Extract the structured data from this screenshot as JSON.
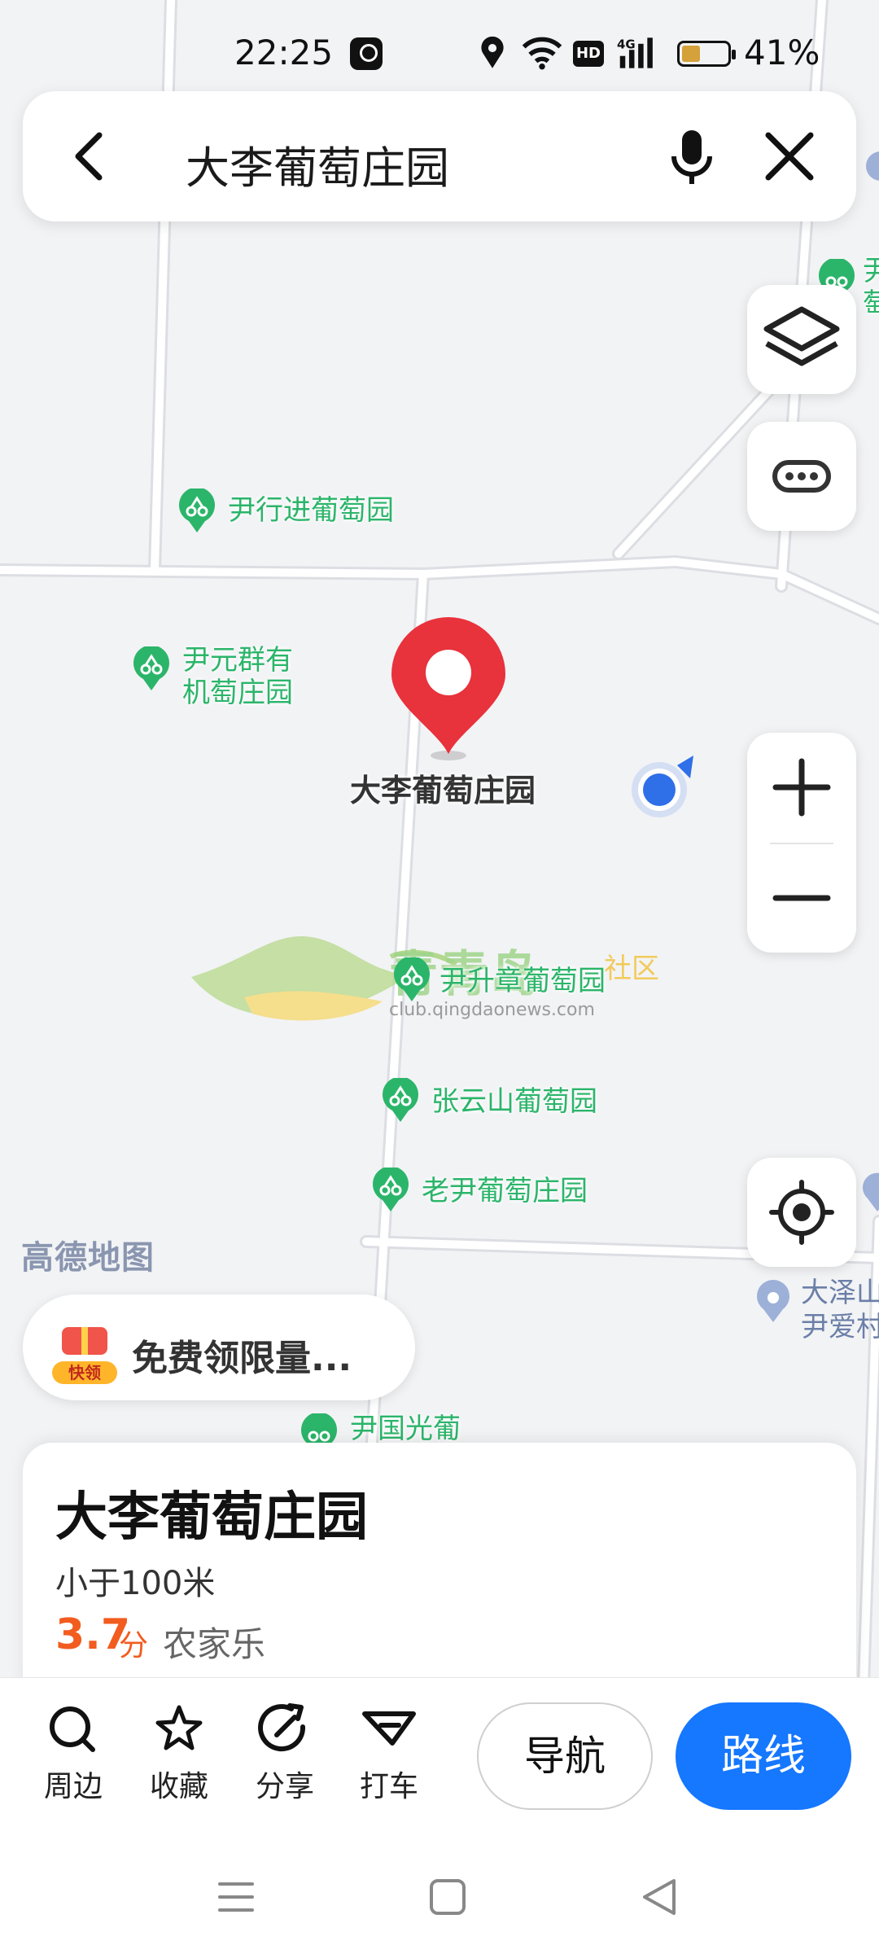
{
  "status_bar": {
    "time": "22:25",
    "battery_percent": "41%",
    "battery_level": 0.41,
    "icons": [
      "app-badge-icon",
      "location-icon",
      "wifi-icon",
      "hd-icon",
      "4g-signal-icon",
      "battery-icon"
    ]
  },
  "search": {
    "query": "大李葡萄庄园",
    "icons": [
      "back-arrow-icon",
      "microphone-icon",
      "close-icon"
    ]
  },
  "map": {
    "brand_watermark": "高德地图",
    "selected_marker_label": "大李葡萄庄园",
    "pois": [
      {
        "label_line1": "尹行进葡萄园",
        "label_line2": ""
      },
      {
        "label_line1": "尹元群有",
        "label_line2": "机萄庄园"
      },
      {
        "label_line1": "尹升章葡萄园",
        "label_line2": ""
      },
      {
        "label_line1": "张云山葡萄园",
        "label_line2": ""
      },
      {
        "label_line1": "老尹葡萄庄园",
        "label_line2": ""
      },
      {
        "label_line1": "尹国光葡",
        "label_line2": ""
      }
    ],
    "edge_labels": {
      "top_right": "尹",
      "top_right_2": "萄",
      "bottom_right_1": "大泽山",
      "bottom_right_2": "尹爱村"
    },
    "overlay_watermark": {
      "brand": "青青岛",
      "suffix": "社区",
      "url": "club.qingdaonews.com"
    },
    "promo": {
      "badge": "快领",
      "text": "免费领限量..."
    },
    "controls": [
      "layers-icon",
      "more-icon",
      "zoom-in-icon",
      "zoom-out-icon",
      "locate-icon"
    ]
  },
  "place_card": {
    "title": "大李葡萄庄园",
    "distance": "小于100米",
    "rating": "3.7",
    "rating_unit": "分",
    "category": "农家乐"
  },
  "actions": {
    "nearby": "周边",
    "favorite": "收藏",
    "share": "分享",
    "taxi": "打车",
    "navigate": "导航",
    "route": "路线"
  },
  "colors": {
    "accent_blue": "#1677ff",
    "poi_green": "#2bb56a",
    "marker_red": "#e8323c",
    "rating_orange": "#f25c1f"
  }
}
